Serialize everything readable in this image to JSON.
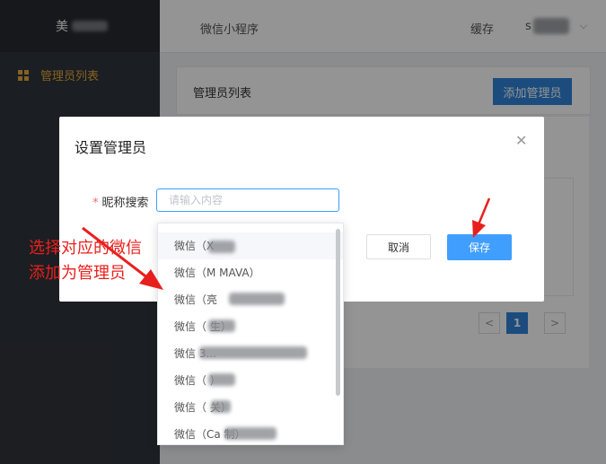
{
  "sidebar": {
    "brand_text": "美",
    "items": [
      {
        "label": "管理员列表",
        "icon": "grid-icon"
      }
    ]
  },
  "topbar": {
    "breadcrumb": "微信小程序",
    "cache": "缓存",
    "user_initial": "s"
  },
  "panel": {
    "title": "管理员列表",
    "add_button": "添加管理员",
    "pagination": {
      "prev": "<",
      "current": "1",
      "next": ">"
    }
  },
  "modal": {
    "title": "设置管理员",
    "required_mark": "*",
    "field_label": "昵称搜索",
    "placeholder": "请输入内容",
    "cancel": "取消",
    "save": "保存"
  },
  "dropdown": {
    "options": [
      "微信（X",
      "微信（M         MAVA）",
      "微信（亮",
      "微信（         生）",
      "微信                                 3...",
      "微信（         ）",
      "微信（         关）",
      "微信（Ca                  制）"
    ]
  },
  "annotation": {
    "line1": "选择对应的微信",
    "line2": "添加为管理员"
  },
  "colors": {
    "accent": "#409eff",
    "annotation": "#e8201d",
    "sidebar": "#30343b",
    "sidebar_active": "#e5a93c"
  }
}
